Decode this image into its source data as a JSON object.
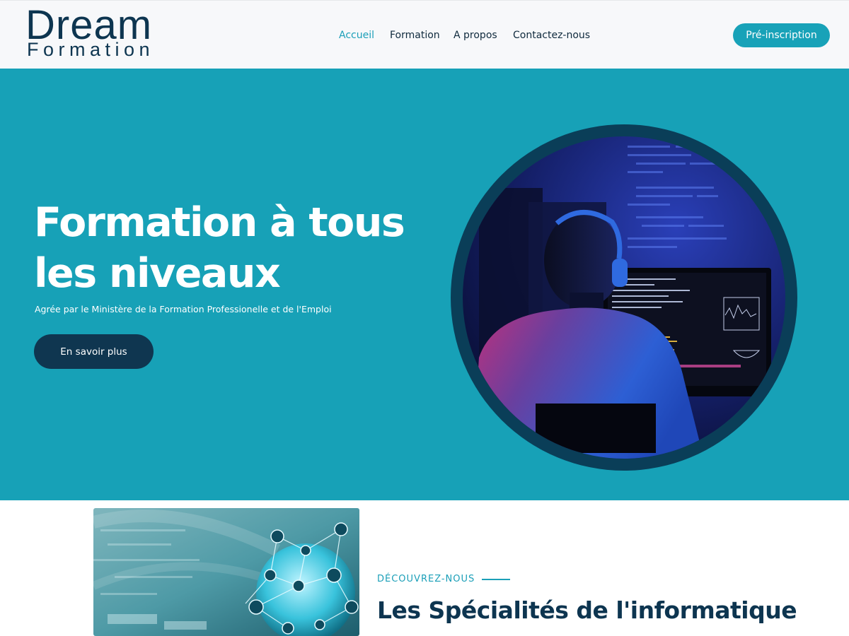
{
  "brand": {
    "line1": "Dream",
    "line2": "Formation"
  },
  "nav": {
    "items": [
      "Accueil",
      "Formation",
      "A propos",
      "Contactez-nous"
    ],
    "active": "Accueil"
  },
  "header": {
    "cta_label": "Pré-inscription"
  },
  "hero": {
    "title_line1": "Formation à tous",
    "title_line2": "les niveaux",
    "subtitle": "Agrée par le Ministère de la Formation Professionelle et de l'Emploi",
    "button_label": "En savoir plus"
  },
  "section": {
    "eyebrow": "DÉCOUVREZ-NOUS",
    "title": "Les Spécialités de l'informatique"
  },
  "colors": {
    "accent": "#17a1b7",
    "navy": "#0d3550",
    "button_dark": "#0f3650",
    "header_bg": "#f7f8fa"
  },
  "images": {
    "hero": "developer-at-monitor-photo",
    "section": "network-globe-photo"
  }
}
